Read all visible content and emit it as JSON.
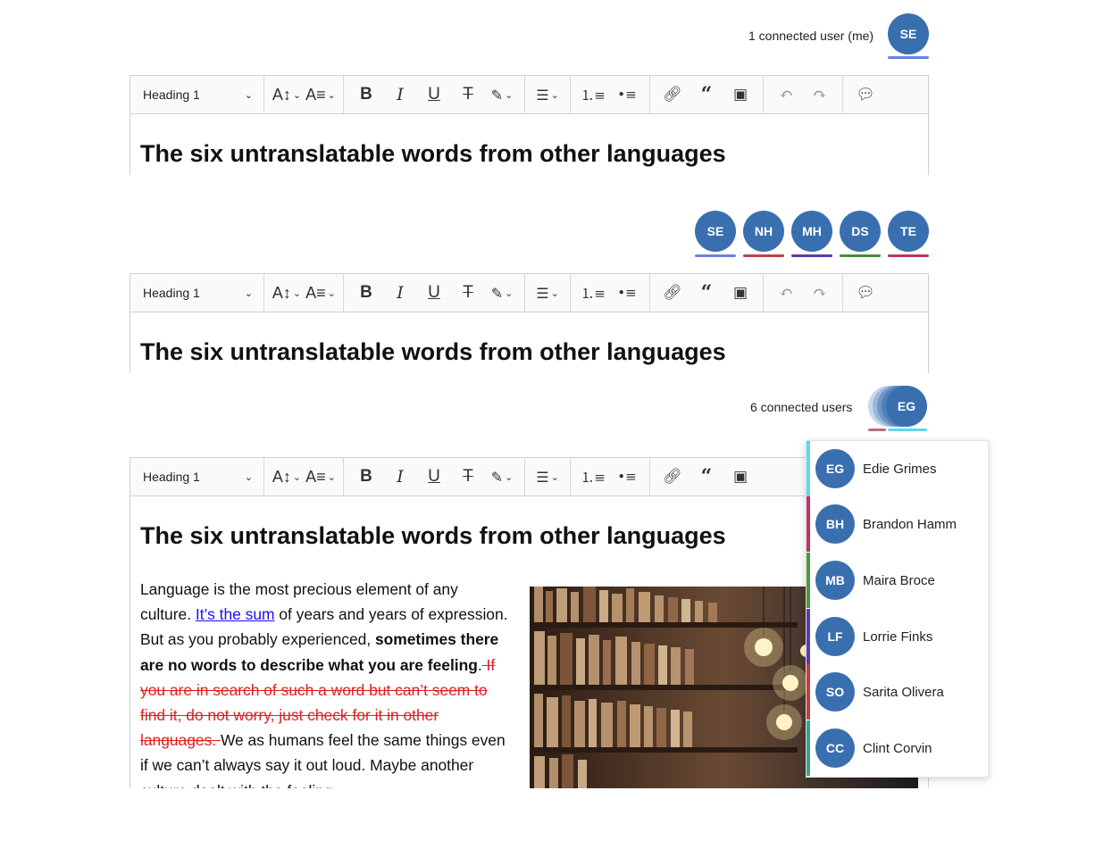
{
  "panel1": {
    "users_text": "1 connected user (me)",
    "avatars": [
      {
        "initials": "SE",
        "color": "#6a80e0"
      }
    ]
  },
  "panel2": {
    "avatars": [
      {
        "initials": "SE",
        "color": "#6a80e0"
      },
      {
        "initials": "NH",
        "color": "#c0404a"
      },
      {
        "initials": "MH",
        "color": "#5a3ab0"
      },
      {
        "initials": "DS",
        "color": "#4a8a3a"
      },
      {
        "initials": "TE",
        "color": "#c0306a"
      }
    ]
  },
  "panel3": {
    "users_text": "6 connected users",
    "stack_avatar": "EG",
    "stack_color": "#5fd8f0",
    "users": [
      {
        "initials": "EG",
        "name": "Edie Grimes",
        "color": "#5fd8f0"
      },
      {
        "initials": "BH",
        "name": "Brandon Hamm",
        "color": "#c0306a"
      },
      {
        "initials": "MB",
        "name": "Maira Broce",
        "color": "#4a9a3a"
      },
      {
        "initials": "LF",
        "name": "Lorrie Finks",
        "color": "#5a3ab0"
      },
      {
        "initials": "SO",
        "name": "Sarita Olivera",
        "color": "#c04040"
      },
      {
        "initials": "CC",
        "name": "Clint Corvin",
        "color": "#3aa090"
      }
    ]
  },
  "toolbar": {
    "heading": "Heading 1",
    "icons": [
      "font-size-icon",
      "font-family-icon",
      "bold-icon",
      "italic-icon",
      "underline-icon",
      "strikethrough-icon",
      "highlight-icon",
      "align-icon",
      "numbered-list-icon",
      "bulleted-list-icon",
      "link-icon",
      "quote-icon",
      "image-icon",
      "undo-icon",
      "redo-icon",
      "comment-icon"
    ]
  },
  "doc": {
    "heading": "The six untranslatable words from other languages",
    "p1_a": "Language is the most precious element of any culture. ",
    "p1_link": "It’s the sum",
    "p1_b": " of years and years of expression. But as you probably experienced, ",
    "p1_bold": "sometimes there are no words to describe what you are feeling",
    "p1_c": ".",
    "p1_strike": " If you are in search of such a word but can’t seem to find it, do not worry, just check for it in other languages. ",
    "p1_d": "We as humans feel the same things even if we can’t always say it out loud. Maybe another culture dealt with the feeling"
  }
}
